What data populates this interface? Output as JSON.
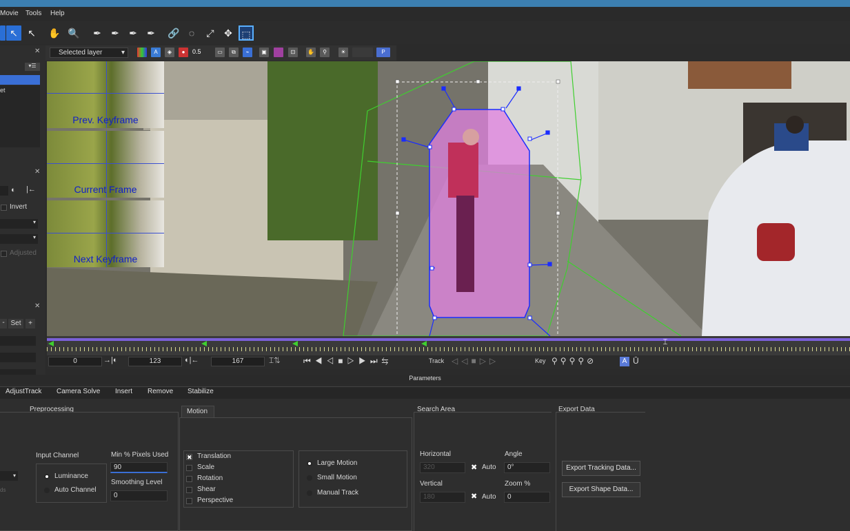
{
  "menu": {
    "movie": "Movie",
    "tools": "Tools",
    "help": "Help"
  },
  "toolbar2": {
    "layer_select": "Selected layer",
    "opacity": "0.5",
    "p_button": "P"
  },
  "viewer": {
    "prev_keyframe": "Prev. Keyframe",
    "current_frame": "Current Frame",
    "next_keyframe": "Next Keyframe"
  },
  "left": {
    "invert": "Invert",
    "adjusted": "Adjusted",
    "set": "Set",
    "minus": "-",
    "plus": "+",
    "frag_et": "et"
  },
  "transport": {
    "start": "0",
    "current": "123",
    "end": "167",
    "track_label": "Track",
    "key_label": "Key"
  },
  "params_label": "Parameters",
  "tabs": [
    "AdjustTrack",
    "Camera Solve",
    "Insert",
    "Remove",
    "Stabilize"
  ],
  "preprocessing": {
    "title": "Preprocessing",
    "input_channel_label": "Input Channel",
    "luminance": "Luminance",
    "auto_channel": "Auto Channel",
    "min_pixels_label": "Min % Pixels Used",
    "min_pixels_value": "90",
    "smoothing_label": "Smoothing Level",
    "smoothing_value": "0"
  },
  "motion": {
    "tab": "Motion",
    "translation": "Translation",
    "scale": "Scale",
    "rotation": "Rotation",
    "shear": "Shear",
    "perspective": "Perspective",
    "large_motion": "Large Motion",
    "small_motion": "Small Motion",
    "manual_track": "Manual Track"
  },
  "search_area": {
    "title": "Search Area",
    "horizontal_label": "Horizontal",
    "horizontal_value": "320",
    "vertical_label": "Vertical",
    "vertical_value": "180",
    "auto1": "Auto",
    "auto2": "Auto",
    "angle_label": "Angle",
    "angle_value": "0°",
    "zoom_label": "Zoom %",
    "zoom_value": "0"
  },
  "export": {
    "title": "Export Data",
    "tracking_btn": "Export Tracking Data...",
    "shape_btn": "Export Shape Data..."
  },
  "colors": {
    "accent": "#2a6fd6",
    "spline_blue": "#1a2cff",
    "spline_green": "#3fcf2f",
    "mask_pink": "#e080e0"
  }
}
